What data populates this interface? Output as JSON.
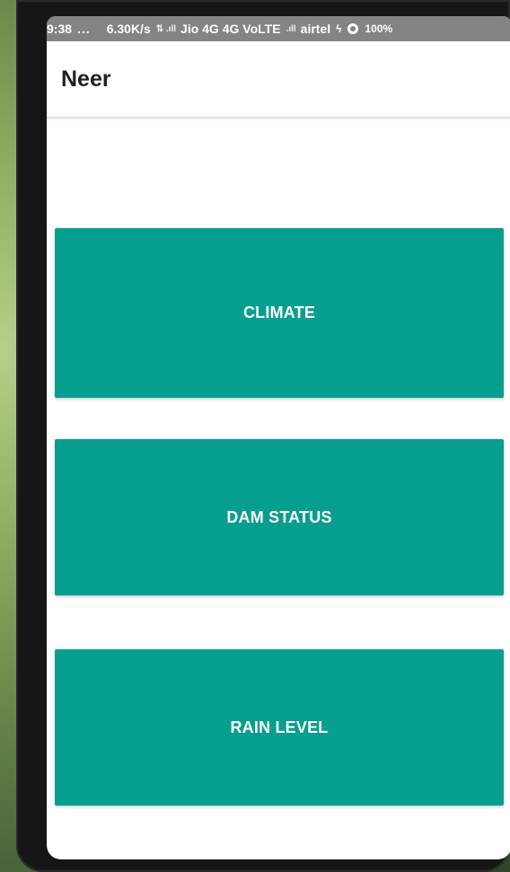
{
  "status_bar": {
    "time": "9:38",
    "dots": "...",
    "speed": "6.30K/s",
    "signal_glyphs": "⇅ .ıll",
    "carrier1": "Jio 4G 4G VoLTE",
    "signal2_glyph": ".ıll",
    "carrier2": "airtel",
    "bolt": "ϟ",
    "battery": "100%"
  },
  "app_bar": {
    "title": "Neer"
  },
  "buttons": {
    "climate": "CLIMATE",
    "dam_status": "DAM STATUS",
    "rain_level": "RAIN LEVEL"
  },
  "colors": {
    "accent": "#069e8f",
    "status_bar": "#848484",
    "background": "#ffffff"
  }
}
